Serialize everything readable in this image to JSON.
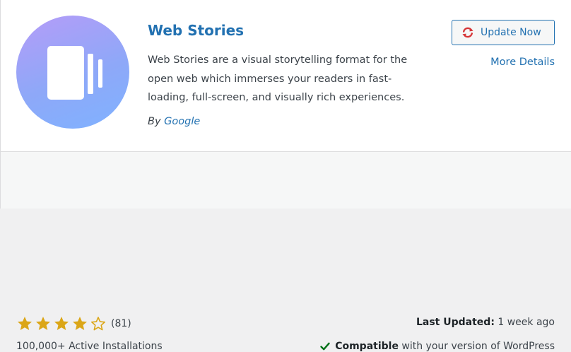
{
  "plugin": {
    "name": "Web Stories",
    "description": "Web Stories are a visual storytelling format for the open web which immerses your readers in fast-loading, full-screen, and visually rich experiences.",
    "author_prefix": "By",
    "author": "Google",
    "icon": "web-stories-logo"
  },
  "actions": {
    "update_label": "Update Now",
    "update_icon": "update-refresh-icon",
    "more_details_label": "More Details"
  },
  "stats": {
    "rating_stars": 4,
    "rating_max": 5,
    "rating_count": "(81)",
    "installs": "100,000+ Active Installations",
    "last_updated_label": "Last Updated:",
    "last_updated_value": "1 week ago",
    "compatible_label": "Compatible",
    "compatible_rest": "with your version of WordPress"
  },
  "colors": {
    "link": "#2271b1",
    "star": "#dba617",
    "check": "#007017",
    "update_icon": "#d63638"
  }
}
